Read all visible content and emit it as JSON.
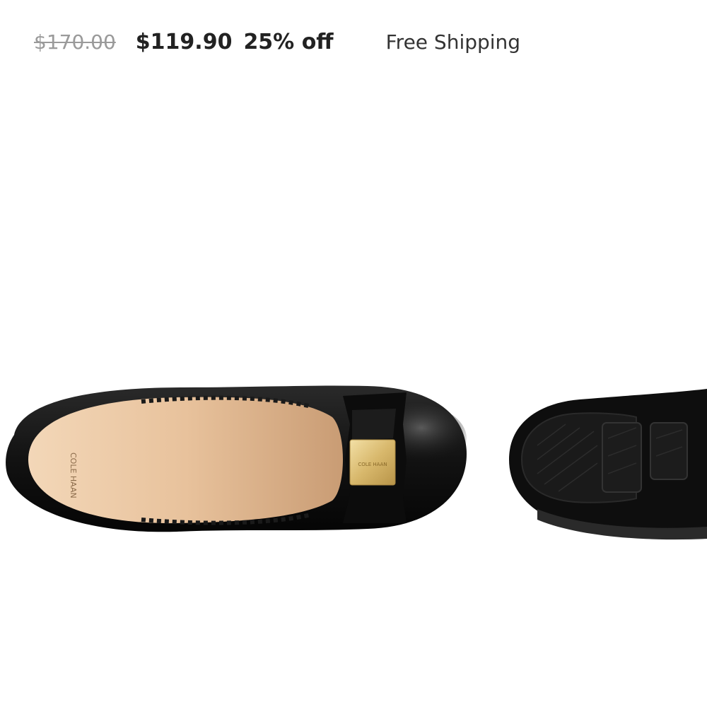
{
  "price": {
    "original": "$170.00",
    "sale": "$119.90",
    "discount": "25% off"
  },
  "shipping": {
    "label": "Free Shipping"
  },
  "colors": {
    "strike_gray": "#9a9a9a",
    "text_dark": "#222222",
    "shoe_black": "#141414",
    "insole_tan": "#e6c09a",
    "hardware_gold": "#d9b96b"
  },
  "product": {
    "image_icon": "ballet-flat-shoe-image"
  }
}
